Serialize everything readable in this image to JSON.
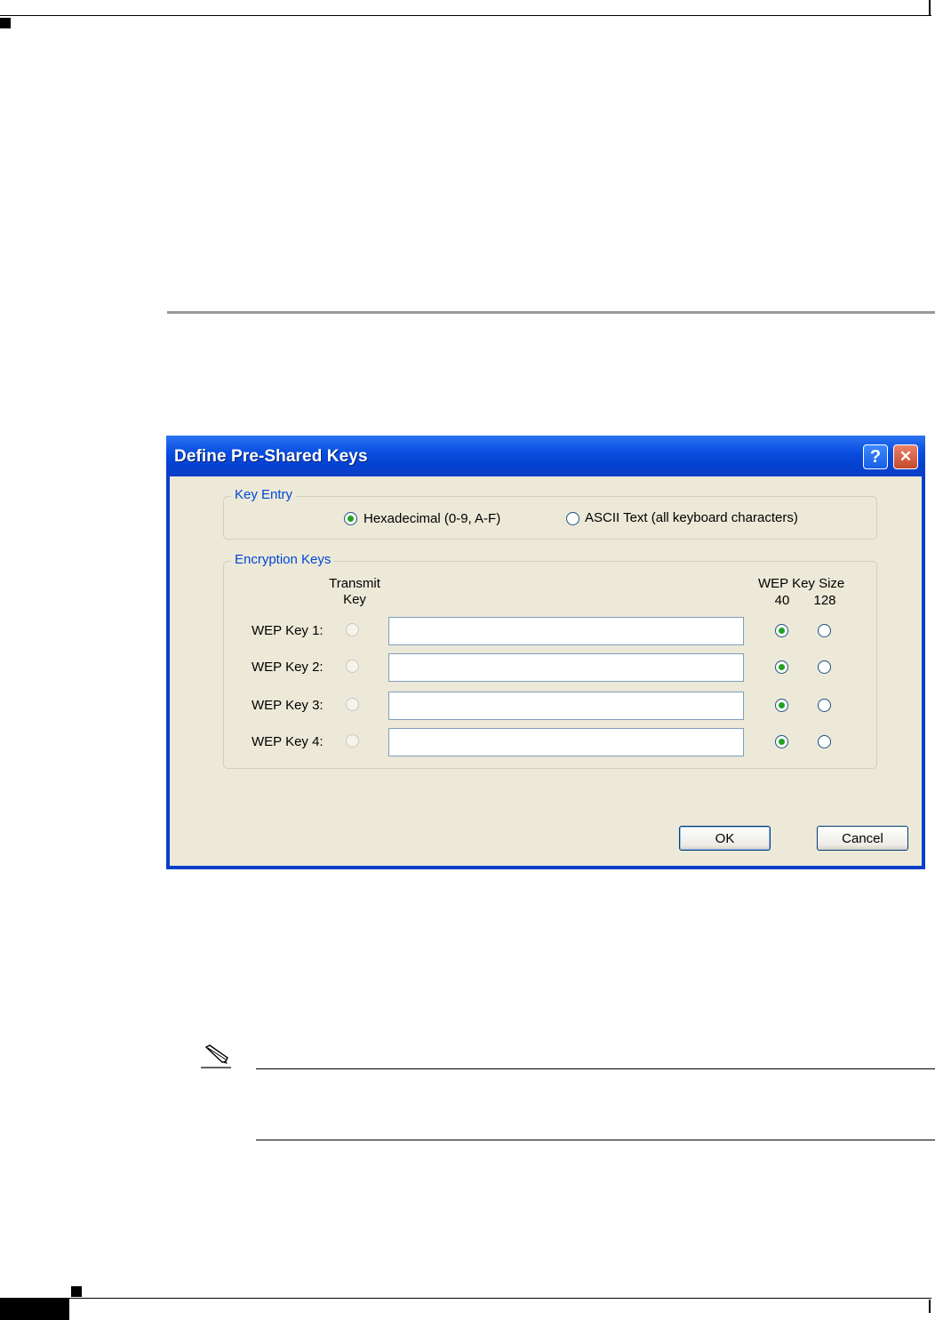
{
  "dialog": {
    "title": "Define Pre-Shared Keys",
    "help_label": "?",
    "close_label": "✕",
    "key_entry": {
      "legend": "Key Entry",
      "options": [
        {
          "label": "Hexadecimal (0-9, A-F)",
          "selected": true
        },
        {
          "label": "ASCII Text (all keyboard characters)",
          "selected": false
        }
      ]
    },
    "encryption_keys": {
      "legend": "Encryption Keys",
      "transmit_header_line1": "Transmit",
      "transmit_header_line2": "Key",
      "size_header": "WEP Key Size",
      "size_40": "40",
      "size_128": "128",
      "rows": [
        {
          "label": "WEP Key 1:",
          "value": "",
          "size": "40"
        },
        {
          "label": "WEP Key 2:",
          "value": "",
          "size": "40"
        },
        {
          "label": "WEP Key 3:",
          "value": "",
          "size": "40"
        },
        {
          "label": "WEP Key 4:",
          "value": "",
          "size": "40"
        }
      ]
    },
    "ok_label": "OK",
    "cancel_label": "Cancel"
  },
  "icons": {
    "note": "pencil-note-icon"
  }
}
